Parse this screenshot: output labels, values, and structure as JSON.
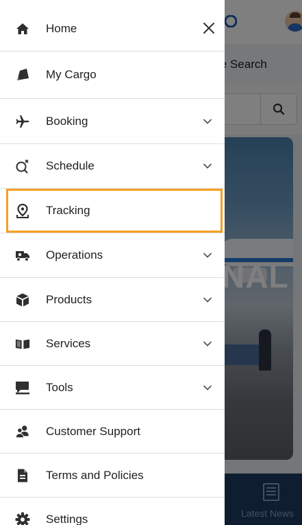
{
  "background": {
    "tab_label": "le Search",
    "banner_text": "NAL",
    "bottom_nav_label": "Latest News"
  },
  "drawer": {
    "close_icon": "close-icon",
    "items": [
      {
        "label": "Home",
        "icon": "home-icon",
        "expandable": false
      },
      {
        "label": "My Cargo",
        "icon": "cargo-icon",
        "expandable": false
      },
      {
        "label": "Booking",
        "icon": "airplane-icon",
        "expandable": true
      },
      {
        "label": "Schedule",
        "icon": "schedule-icon",
        "expandable": true
      },
      {
        "label": "Tracking",
        "icon": "map-pin-icon",
        "expandable": false,
        "highlighted": true
      },
      {
        "label": "Operations",
        "icon": "truck-icon",
        "expandable": true
      },
      {
        "label": "Products",
        "icon": "box-icon",
        "expandable": true
      },
      {
        "label": "Services",
        "icon": "book-icon",
        "expandable": true
      },
      {
        "label": "Tools",
        "icon": "tools-icon",
        "expandable": true
      },
      {
        "label": "Customer Support",
        "icon": "users-icon",
        "expandable": false
      },
      {
        "label": "Terms and Policies",
        "icon": "document-icon",
        "expandable": false
      },
      {
        "label": "Settings",
        "icon": "gear-icon",
        "expandable": false
      }
    ]
  },
  "colors": {
    "highlight": "#f5a021",
    "icon": "#2f2f2f",
    "bottom_nav": "#1f3b61"
  }
}
